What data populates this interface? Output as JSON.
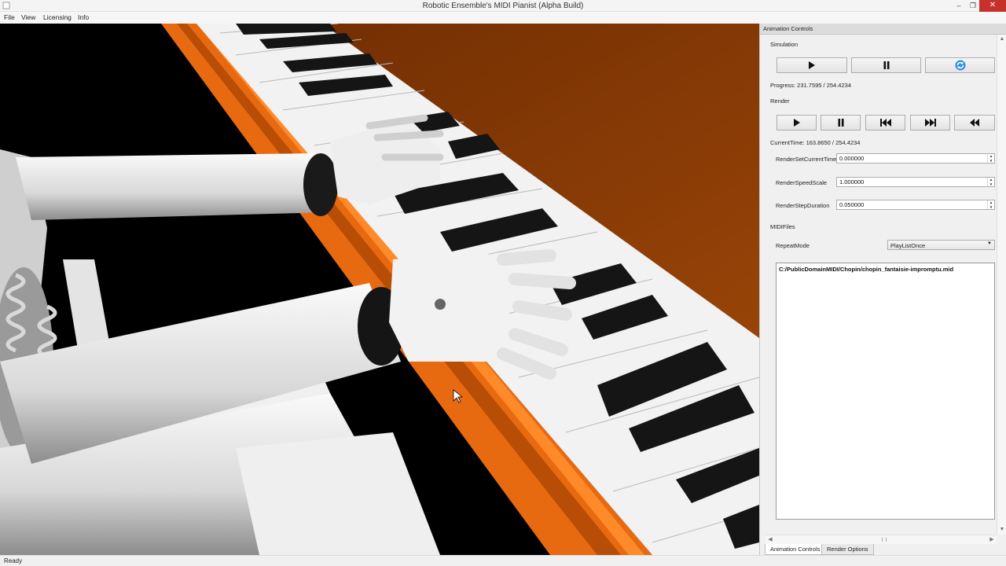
{
  "window": {
    "title": "Robotic Ensemble's MIDI Pianist (Alpha Build)",
    "minimize_glyph": "–",
    "maximize_glyph": "❐",
    "close_glyph": "✕"
  },
  "menu": [
    "File",
    "View",
    "Licensing",
    "Info"
  ],
  "dock": {
    "title": "Animation Controls",
    "simulation": {
      "label": "Simulation",
      "progress": "Progress: 231.7595 / 254.4234",
      "buttons": [
        "play-icon",
        "pause-icon",
        "reset-icon"
      ]
    },
    "render": {
      "label": "Render",
      "current_time": "CurrentTime: 163.8650 / 254.4234",
      "buttons": [
        "play-icon",
        "pause-icon",
        "skip-back-icon",
        "skip-forward-icon",
        "rewind-icon"
      ]
    },
    "fields": [
      {
        "label": "RenderSetCurrentTime",
        "value": "0.000000"
      },
      {
        "label": "RenderSpeedScale",
        "value": "1.000000"
      },
      {
        "label": "RenderStepDuration",
        "value": "0.050000"
      }
    ],
    "midi": {
      "label": "MIDIFiles",
      "repeat_label": "RepeatMode",
      "repeat_value": "PlayListOnce",
      "files": [
        "C:/PublicDomainMIDI/Chopin/chopin_fantaisie-impromptu.mid"
      ]
    },
    "tabs": [
      "Animation Controls",
      "Render Options"
    ]
  },
  "status": "Ready",
  "colors": {
    "wood_orange": "#e86a10",
    "backdrop": "#8a3c05",
    "close_red": "#c7302b"
  }
}
